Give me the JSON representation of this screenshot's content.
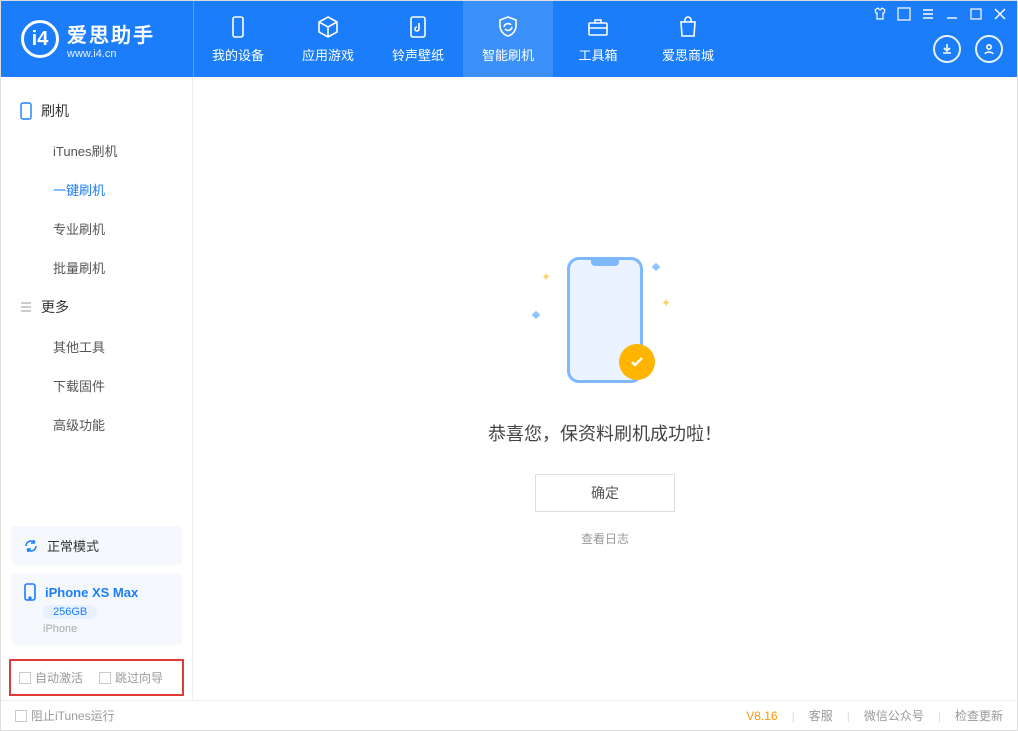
{
  "app": {
    "title": "爱思助手",
    "url": "www.i4.cn"
  },
  "topTabs": [
    {
      "label": "我的设备"
    },
    {
      "label": "应用游戏"
    },
    {
      "label": "铃声壁纸"
    },
    {
      "label": "智能刷机"
    },
    {
      "label": "工具箱"
    },
    {
      "label": "爱思商城"
    }
  ],
  "sidebar": {
    "group1": {
      "title": "刷机"
    },
    "items1": [
      {
        "label": "iTunes刷机"
      },
      {
        "label": "一键刷机"
      },
      {
        "label": "专业刷机"
      },
      {
        "label": "批量刷机"
      }
    ],
    "group2": {
      "title": "更多"
    },
    "items2": [
      {
        "label": "其他工具"
      },
      {
        "label": "下载固件"
      },
      {
        "label": "高级功能"
      }
    ],
    "mode": "正常模式",
    "device": {
      "name": "iPhone XS Max",
      "storage": "256GB",
      "type": "iPhone"
    },
    "checkboxes": {
      "autoActivate": "自动激活",
      "skipGuide": "跳过向导"
    }
  },
  "main": {
    "successMessage": "恭喜您，保资料刷机成功啦！",
    "okButton": "确定",
    "viewLog": "查看日志"
  },
  "statusbar": {
    "blockItunes": "阻止iTunes运行",
    "version": "V8.16",
    "support": "客服",
    "wechat": "微信公众号",
    "update": "检查更新"
  }
}
